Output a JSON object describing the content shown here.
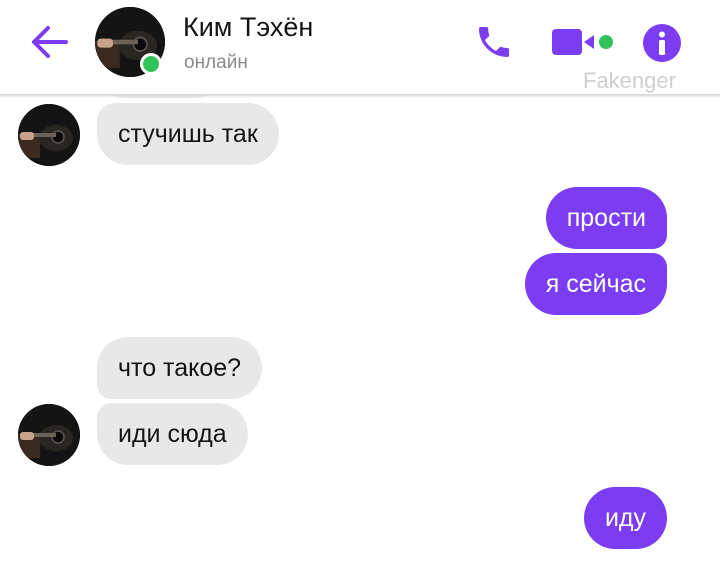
{
  "header": {
    "contact_name": "Ким Тэхён",
    "status": "онлайн",
    "watermark": "Fakenger",
    "icons": {
      "back": "arrow-left-icon",
      "call": "phone-icon",
      "video": "video-camera-icon",
      "info": "info-icon"
    },
    "accent_color": "#7b3cf2",
    "online_color": "#2fc35a"
  },
  "messages": [
    {
      "side": "incoming",
      "text": "стучишь так"
    },
    {
      "side": "outgoing",
      "text": "прости"
    },
    {
      "side": "outgoing",
      "text": "я сейчас"
    },
    {
      "side": "incoming",
      "text": "что такое?"
    },
    {
      "side": "incoming",
      "text": "иди сюда"
    },
    {
      "side": "outgoing",
      "text": "иду"
    }
  ],
  "colors": {
    "incoming_bubble": "#e8e8e8",
    "outgoing_bubble": "#7b3cf2",
    "incoming_text": "#141414",
    "outgoing_text": "#ffffff"
  }
}
